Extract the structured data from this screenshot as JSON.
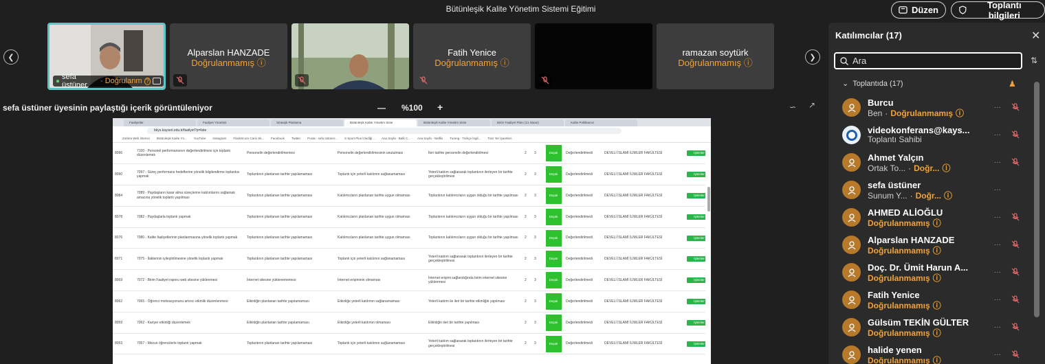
{
  "window": {
    "title": "Bütünleşik Kalite Yönetim Sistemi Eğitimi",
    "layout_button": "Düzen",
    "info_button": "Toplantı bilgileri"
  },
  "tiles": [
    {
      "name": "sefa üstüner",
      "status": "Doğrulanm"
    },
    {
      "name": "Alparslan HANZADE",
      "status": "Doğrulanmamış"
    },
    {
      "name": "",
      "status": ""
    },
    {
      "name": "Fatih Yenice",
      "status": "Doğrulanmamış"
    },
    {
      "name": "",
      "status": ""
    },
    {
      "name": "ramazan soytürk",
      "status": "Doğrulanmamış"
    }
  ],
  "share": {
    "label": "sefa üstüner üyesinin paylaştığı içerik görüntüleniyor",
    "zoom": "%100",
    "zoom_out": "—",
    "zoom_in": "+"
  },
  "browser": {
    "tabs": [
      "Faaliyetler",
      "Faaliyet Yönetimi",
      "Stratejik Planlama",
      "Bütünleşik Kalite Yönetim Siste",
      "Bütünleşik Kalite Yönetim Siste",
      "Birim Faaliyet Planı (21 Nisan)",
      "Kalite Politikamız"
    ],
    "url": "bkys.kayseri.edu.tr/faaliyet?p=liste",
    "bookmarks": [
      "Zimbra Web İstemci",
      "Bütünleşik Kalite Yö...",
      "YouTube",
      "Instagram",
      "FlashScore Canlı Sk...",
      "Facebook",
      "Twitter",
      "Posta - sefa üstüner...",
      "S Sport Plus İzlediği...",
      "Ana Sayfa - Bafk C...",
      "Ana Sayfa - Netflix",
      "Tureng - Türkçe İngil...",
      "Tüm Yer İşaretleri"
    ]
  },
  "table": {
    "status_label": "Düşük",
    "unit": "DEVELİ İSLAMİ İLİMLER FAKÜLTESİ",
    "eval": "Değerlendirilmedi",
    "action": "İşlemler",
    "rows": [
      {
        "id": "8096",
        "task": "7100 - Personel performansının değerlendirilmesi için toplantı düzenlemek",
        "risk": "Personelin değerlendirilmemesi",
        "cause": "Personelin değerlendirilmesinin unutulması",
        "measure": "İleri tarihte personelin değerlendirilmesi",
        "a": "2",
        "b": "3"
      },
      {
        "id": "8090",
        "task": "7097 - Süreç performans hedeflerine yönelik bilgilendirme toplantısı yapmak",
        "risk": "Toplantının planlanan tarihte yapılamaması",
        "cause": "Toplantı için yeterli katılımın sağlanamaması",
        "measure": "Yeterli katılım sağlanarak toplantının ilerleyen bir tarihte gerçekleştirilmesi",
        "a": "2",
        "b": "3"
      },
      {
        "id": "8084",
        "task": "7089 - Paydaşların karar alma süreçlerine katılımlarını sağlamak amacına yönelik toplantı yapılması",
        "risk": "Toplantının planlanan tarihte yapılamaması",
        "cause": "Katılımcıların planlanan tarihte uygun olmaması",
        "measure": "Toplantının katılımcıların uygun olduğu bir tarihte yapılması",
        "a": "2",
        "b": "3"
      },
      {
        "id": "8078",
        "task": "7082 - Paydaşlarla toplantı yapmak",
        "risk": "Toplantının planlanan tarihte yapılamaması",
        "cause": "Katılımcıların planlanan tarihte uygun olmaması",
        "measure": "Toplantının katılımcıların uygun olduğu bir tarihte yapılması",
        "a": "2",
        "b": "3"
      },
      {
        "id": "8076",
        "task": "7080 - Kalite faaliyetlerinin planlanmasına yönelik toplantı yapmak",
        "risk": "Toplantının planlanan tarihte yapılamaması",
        "cause": "Katılımcıların planlanan tarihte uygun olmaması",
        "measure": "Toplantının katılımcıların uygun olduğu bir tarihte yapılması",
        "a": "2",
        "b": "3"
      },
      {
        "id": "8071",
        "task": "7075 - İlaklerinin iyileştirilmesine yönelik toplantı yapmak",
        "risk": "Toplantının planlanan tarihte yapılamaması",
        "cause": "Toplantı için yeterli katılımın sağlanamaması",
        "measure": "Yeterli katılım sağlanarak toplantının ilerleyen bir tarihte gerçekleştirilmesi",
        "a": "2",
        "b": "3"
      },
      {
        "id": "8069",
        "task": "7072 - Birim Faaliyet raporu web sitesine yüklenmesi",
        "risk": "İnternet sitesine yüklenememesi",
        "cause": "İnternet erişiminin olmaması",
        "measure": "İnternet erişimi sağlandığında birim internet sitesine yüklenmesi",
        "a": "2",
        "b": "3"
      },
      {
        "id": "8062",
        "task": "7065 - Öğrenci motivasyonunu artırıcı etkinlik düzenlenmesi",
        "risk": "Etkinliğin planlanan tarihte yapılamaması",
        "cause": "Etkinliğe yeterli katılımın sağlanamaması",
        "measure": "Yeterli katılım ile ileri bir tarihte etkinliğin yapılması",
        "a": "2",
        "b": "3"
      },
      {
        "id": "8059",
        "task": "7062 - Kariyer etkinliği düzenlemek",
        "risk": "Etkinliğin planlanan tarihte yapılamaması",
        "cause": "Etkinliğe yeterli katılımın olmaması",
        "measure": "Etkinliğin ileri bir tarihte yapılması",
        "a": "2",
        "b": "3"
      },
      {
        "id": "8053",
        "task": "7057 - Mezun öğrencilerle toplantı yapmak",
        "risk": "Toplantının planlanan tarihte yapılamaması",
        "cause": "Toplantı için yeterli katılımın sağlanamaması",
        "measure": "Yeterli katılım sağlanarak toplantının ilerleyen bir tarihte gerçekleştirilmesi",
        "a": "2",
        "b": "3"
      }
    ]
  },
  "panel": {
    "title": "Katılımcılar (17)",
    "search_placeholder": "Ara",
    "group": "Toplantıda (17)",
    "participants": [
      {
        "name": "Burcu",
        "role": "Ben",
        "status": "Doğrulanmamış"
      },
      {
        "name": "videokonferans@kays...",
        "role": "Toplantı Sahibi",
        "status": ""
      },
      {
        "name": "Ahmet Yalçın",
        "role": "Ortak To...",
        "status": "Doğr..."
      },
      {
        "name": "sefa üstüner",
        "role": "Sunum Y...",
        "status": "Doğr..."
      },
      {
        "name": "AHMED ALİOĞLU",
        "role": "",
        "status": "Doğrulanmamış"
      },
      {
        "name": "Alparslan HANZADE",
        "role": "",
        "status": "Doğrulanmamış"
      },
      {
        "name": "Doç. Dr. Ümit Harun A...",
        "role": "",
        "status": "Doğrulanmamış"
      },
      {
        "name": "Fatih Yenice",
        "role": "",
        "status": "Doğrulanmamış"
      },
      {
        "name": "Gülsüm TEKİN GÜLTER",
        "role": "",
        "status": "Doğrulanmamış"
      },
      {
        "name": "halide yenen",
        "role": "",
        "status": "Doğrulanmamış"
      }
    ]
  },
  "colors": {
    "accent": "#f2a336",
    "mute": "#e86a6a",
    "ok": "#2ec02e"
  }
}
